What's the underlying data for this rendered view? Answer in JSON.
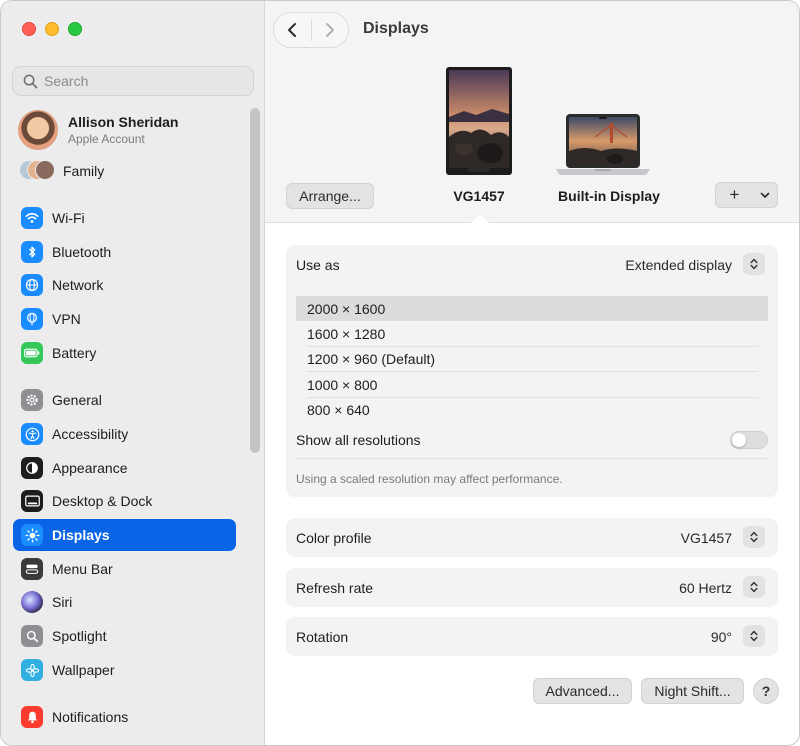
{
  "window": {
    "title": "Displays"
  },
  "sidebar": {
    "search_placeholder": "Search",
    "account": {
      "name": "Allison Sheridan",
      "subtitle": "Apple Account"
    },
    "family_label": "Family",
    "items": [
      {
        "label": "Wi-Fi",
        "icon": "wifi-icon",
        "color": "#1a8cff"
      },
      {
        "label": "Bluetooth",
        "icon": "bluetooth-icon",
        "color": "#1a8cff"
      },
      {
        "label": "Network",
        "icon": "globe-icon",
        "color": "#1a8cff"
      },
      {
        "label": "VPN",
        "icon": "vpn-globe-icon",
        "color": "#1a8cff"
      },
      {
        "label": "Battery",
        "icon": "battery-icon",
        "color": "#34c759"
      },
      {
        "label": "General",
        "icon": "gear-icon",
        "color": "#8e8e93"
      },
      {
        "label": "Accessibility",
        "icon": "accessibility-icon",
        "color": "#1a8cff"
      },
      {
        "label": "Appearance",
        "icon": "appearance-icon",
        "color": "#1d1d1f"
      },
      {
        "label": "Desktop & Dock",
        "icon": "dock-icon",
        "color": "#1d1d1f"
      },
      {
        "label": "Displays",
        "icon": "sun-icon",
        "color": "#1a8cff",
        "selected": true
      },
      {
        "label": "Menu Bar",
        "icon": "menubar-icon",
        "color": "#3a3a3c"
      },
      {
        "label": "Siri",
        "icon": "siri-icon",
        "color": "#2c2c2e"
      },
      {
        "label": "Spotlight",
        "icon": "magnifier-icon",
        "color": "#8e8e93"
      },
      {
        "label": "Wallpaper",
        "icon": "flower-icon",
        "color": "#30b0e0"
      },
      {
        "label": "Notifications",
        "icon": "bell-icon",
        "color": "#ff3b30"
      }
    ]
  },
  "header": {
    "arrange_label": "Arrange...",
    "displays": [
      {
        "name": "VG1457",
        "selected": true
      },
      {
        "name": "Built-in Display",
        "selected": false
      }
    ],
    "add_label": "+",
    "dropdown_icon": "chevron-down-icon"
  },
  "settings": {
    "use_as": {
      "label": "Use as",
      "value": "Extended display"
    },
    "resolutions": [
      {
        "label": "2000 × 1600",
        "selected": true
      },
      {
        "label": "1600 × 1280",
        "selected": false
      },
      {
        "label": "1200 × 960 (Default)",
        "selected": false
      },
      {
        "label": "1000 × 800",
        "selected": false
      },
      {
        "label": "800 × 640",
        "selected": false
      }
    ],
    "show_all_label": "Show all resolutions",
    "show_all_enabled": false,
    "scaled_note": "Using a scaled resolution may affect performance.",
    "color_profile": {
      "label": "Color profile",
      "value": "VG1457"
    },
    "refresh_rate": {
      "label": "Refresh rate",
      "value": "60 Hertz"
    },
    "rotation": {
      "label": "Rotation",
      "value": "90°"
    }
  },
  "footer": {
    "advanced_label": "Advanced...",
    "night_shift_label": "Night Shift...",
    "help_label": "?"
  },
  "colors": {
    "accent": "#0a64e6",
    "sidebar_bg": "#ececec",
    "card_bg": "#f3f3f3"
  }
}
